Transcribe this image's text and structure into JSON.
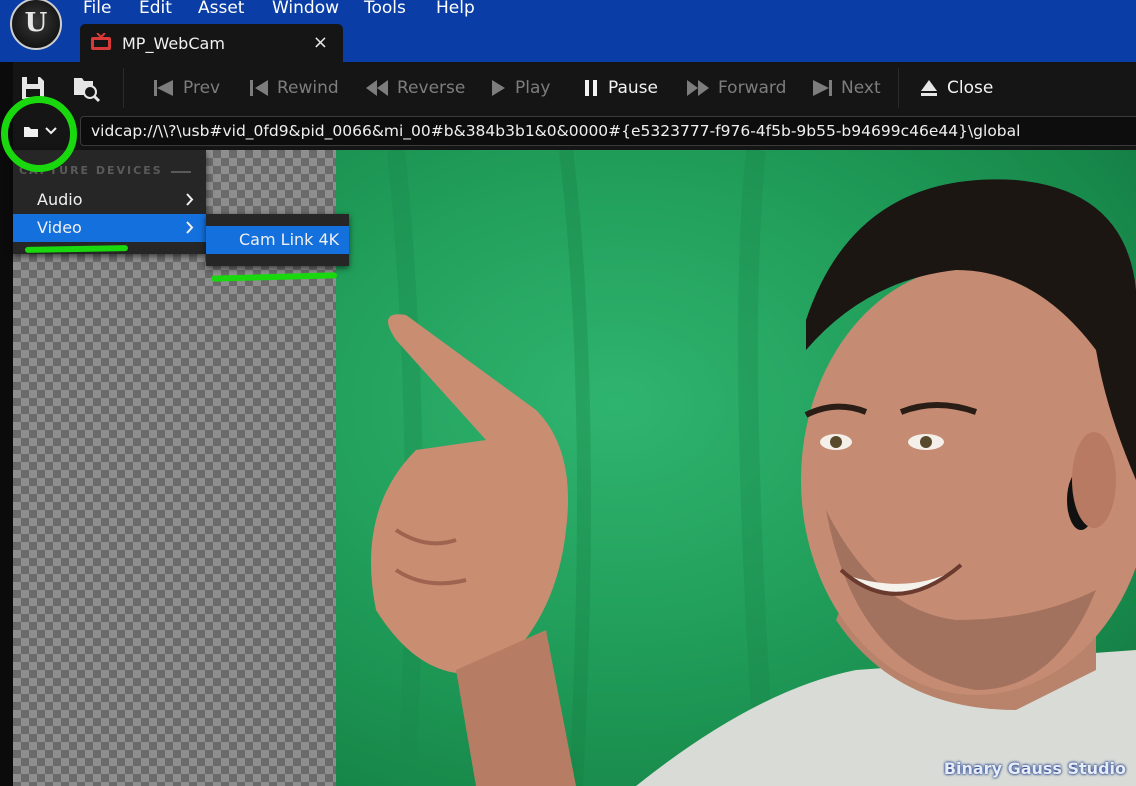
{
  "app": {
    "logo_letter": "U"
  },
  "menu": [
    "File",
    "Edit",
    "Asset",
    "Window",
    "Tools",
    "Help"
  ],
  "tab": {
    "title": "MP_WebCam",
    "close": "×",
    "icon": "tv-icon"
  },
  "toolbar": {
    "buttons": [
      {
        "label": "Prev",
        "icon": "prev-icon",
        "active": false
      },
      {
        "label": "Rewind",
        "icon": "rewind-icon",
        "active": false
      },
      {
        "label": "Reverse",
        "icon": "reverse-icon",
        "active": false
      },
      {
        "label": "Play",
        "icon": "play-icon",
        "active": false
      },
      {
        "label": "Pause",
        "icon": "pause-icon",
        "active": true
      },
      {
        "label": "Forward",
        "icon": "forward-icon",
        "active": false
      },
      {
        "label": "Next",
        "icon": "next-icon",
        "active": false
      },
      {
        "label": "Close",
        "icon": "eject-icon",
        "active": true
      }
    ]
  },
  "url": {
    "value": "vidcap://\\\\?\\usb#vid_0fd9&pid_0066&mi_00#b&384b3b1&0&0000#{e5323777-f976-4f5b-9b55-b94699c46e44}\\global"
  },
  "source_menu": {
    "header": "CAPTURE DEVICES",
    "items": [
      {
        "label": "Audio",
        "selected": false
      },
      {
        "label": "Video",
        "selected": true
      }
    ],
    "submenu": {
      "items": [
        "Cam Link 4K"
      ]
    }
  },
  "watermark": "Binary Gauss Studio",
  "colors": {
    "menubar": "#0a3ea6",
    "highlight": "#1470dc",
    "annotation": "#19d80e",
    "background": "#151515"
  }
}
